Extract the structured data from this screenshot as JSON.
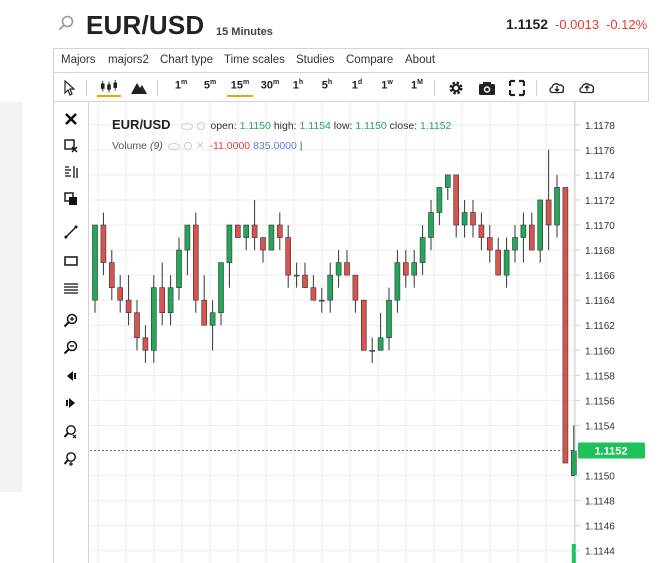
{
  "header": {
    "symbol": "EUR/USD",
    "interval": "15 Minutes",
    "last": "1.1152",
    "change": "-0.0013",
    "change_pct": "-0.12%"
  },
  "menu": [
    "Majors",
    "majors2",
    "Chart type",
    "Time scales",
    "Studies",
    "Compare",
    "About"
  ],
  "toolbar": {
    "timeframes": [
      {
        "label": "1",
        "sup": "m"
      },
      {
        "label": "5",
        "sup": "m"
      },
      {
        "label": "15",
        "sup": "m",
        "active": true
      },
      {
        "label": "30",
        "sup": "m"
      },
      {
        "label": "1",
        "sup": "h"
      },
      {
        "label": "5",
        "sup": "h"
      },
      {
        "label": "1",
        "sup": "d"
      },
      {
        "label": "1",
        "sup": "w"
      },
      {
        "label": "1",
        "sup": "M"
      }
    ],
    "icons": [
      "cursor-icon",
      "candles-icon",
      "mountain-icon",
      "gear-icon",
      "camera-icon",
      "fullscreen-icon",
      "download-icon",
      "upload-icon"
    ]
  },
  "drawing_tools": [
    "close-icon",
    "remove-drawing-icon",
    "measure-icon",
    "copy-icon",
    "line-tool-icon",
    "rectangle-icon",
    "fib-icon",
    "zoom-in-icon",
    "zoom-out-icon",
    "scroll-left-icon",
    "scroll-right-icon",
    "zoom-fit-icon",
    "zoom-reset-icon"
  ],
  "legend": {
    "symbol": "EUR/USD",
    "open_label": "open:",
    "open": "1.1150",
    "high_label": "high:",
    "high": "1.1154",
    "low_label": "low:",
    "low": "1.1150",
    "close_label": "close:",
    "close": "1.1152",
    "volume_label": "Volume",
    "volume_period": "(9)",
    "volume_value": "-11.0000",
    "volume_ma": "835.0000",
    "volume_cursor": "|"
  },
  "price_axis": {
    "ticks": [
      "1.1178",
      "1.1176",
      "1.1174",
      "1.1172",
      "1.1170",
      "1.1168",
      "1.1166",
      "1.1164",
      "1.1162",
      "1.1160",
      "1.1158",
      "1.1156",
      "1.1154",
      "1.1152",
      "1.1150",
      "1.1148",
      "1.1146",
      "1.1144"
    ],
    "current": "1.1152"
  },
  "colors": {
    "up": "#26a65b",
    "down": "#d9534f",
    "accent": "#f0a000",
    "price_tag": "#1fc25a"
  },
  "chart_data": {
    "type": "candlestick",
    "ylim": [
      1.11435,
      1.11795
    ],
    "candles": [
      [
        1.1164,
        1.117,
        1.1163,
        1.117
      ],
      [
        1.117,
        1.1171,
        1.1166,
        1.1167
      ],
      [
        1.1167,
        1.1168,
        1.1164,
        1.1165
      ],
      [
        1.1165,
        1.1166,
        1.1163,
        1.1164
      ],
      [
        1.1164,
        1.1166,
        1.1162,
        1.1163
      ],
      [
        1.1163,
        1.1164,
        1.116,
        1.1161
      ],
      [
        1.1161,
        1.1162,
        1.1159,
        1.116
      ],
      [
        1.116,
        1.1166,
        1.1159,
        1.1165
      ],
      [
        1.1165,
        1.1167,
        1.1162,
        1.1163
      ],
      [
        1.1163,
        1.1166,
        1.1162,
        1.1165
      ],
      [
        1.1165,
        1.1169,
        1.1164,
        1.1168
      ],
      [
        1.1168,
        1.117,
        1.1166,
        1.117
      ],
      [
        1.117,
        1.1171,
        1.1163,
        1.1164
      ],
      [
        1.1164,
        1.1166,
        1.1162,
        1.1162
      ],
      [
        1.1162,
        1.1164,
        1.116,
        1.1163
      ],
      [
        1.1163,
        1.1167,
        1.1162,
        1.1167
      ],
      [
        1.1167,
        1.117,
        1.1165,
        1.117
      ],
      [
        1.117,
        1.117,
        1.1169,
        1.1169
      ],
      [
        1.1169,
        1.117,
        1.1168,
        1.117
      ],
      [
        1.117,
        1.1172,
        1.1168,
        1.1169
      ],
      [
        1.1169,
        1.1169,
        1.1167,
        1.1168
      ],
      [
        1.1168,
        1.117,
        1.1168,
        1.117
      ],
      [
        1.117,
        1.1171,
        1.1168,
        1.1169
      ],
      [
        1.1169,
        1.117,
        1.1165,
        1.1166
      ],
      [
        1.1166,
        1.1167,
        1.1165,
        1.1166
      ],
      [
        1.1166,
        1.1167,
        1.1165,
        1.1165
      ],
      [
        1.1165,
        1.1166,
        1.1164,
        1.1164
      ],
      [
        1.1164,
        1.1165,
        1.1163,
        1.1164
      ],
      [
        1.1164,
        1.1167,
        1.1163,
        1.1166
      ],
      [
        1.1166,
        1.1168,
        1.1165,
        1.1167
      ],
      [
        1.1167,
        1.1168,
        1.1166,
        1.1166
      ],
      [
        1.1166,
        1.1166,
        1.1163,
        1.1164
      ],
      [
        1.1164,
        1.1164,
        1.116,
        1.116
      ],
      [
        1.116,
        1.1161,
        1.1159,
        1.116
      ],
      [
        1.116,
        1.1163,
        1.116,
        1.1161
      ],
      [
        1.1161,
        1.1165,
        1.116,
        1.1164
      ],
      [
        1.1164,
        1.1168,
        1.1163,
        1.1167
      ],
      [
        1.1167,
        1.1168,
        1.1165,
        1.1166
      ],
      [
        1.1166,
        1.1168,
        1.1165,
        1.1167
      ],
      [
        1.1167,
        1.117,
        1.1166,
        1.1169
      ],
      [
        1.1169,
        1.1172,
        1.1168,
        1.1171
      ],
      [
        1.1171,
        1.1173,
        1.117,
        1.1173
      ],
      [
        1.1173,
        1.1174,
        1.1172,
        1.1174
      ],
      [
        1.1174,
        1.1174,
        1.1169,
        1.117
      ],
      [
        1.117,
        1.1172,
        1.1169,
        1.1171
      ],
      [
        1.1171,
        1.1172,
        1.1169,
        1.117
      ],
      [
        1.117,
        1.1171,
        1.1168,
        1.1169
      ],
      [
        1.1169,
        1.117,
        1.1167,
        1.1168
      ],
      [
        1.1168,
        1.1169,
        1.1166,
        1.1166
      ],
      [
        1.1166,
        1.1169,
        1.1165,
        1.1168
      ],
      [
        1.1168,
        1.117,
        1.1167,
        1.1169
      ],
      [
        1.1169,
        1.1171,
        1.1167,
        1.117
      ],
      [
        1.117,
        1.1171,
        1.1168,
        1.1168
      ],
      [
        1.1168,
        1.1172,
        1.1167,
        1.1172
      ],
      [
        1.1172,
        1.1176,
        1.1168,
        1.117
      ],
      [
        1.117,
        1.1174,
        1.1169,
        1.1173
      ],
      [
        1.1173,
        1.1173,
        1.1151,
        1.1151
      ],
      [
        1.115,
        1.1154,
        1.115,
        1.1152
      ]
    ]
  }
}
